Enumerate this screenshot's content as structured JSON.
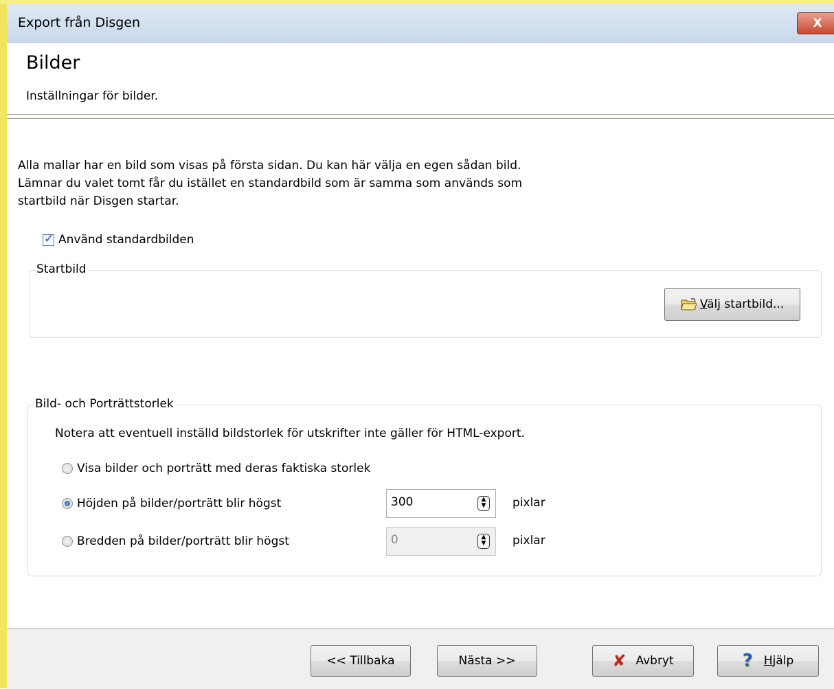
{
  "window": {
    "title": "Export från Disgen",
    "close_label": "X",
    "colors": {
      "accent_yellow": "#f0e460",
      "titlebar": "#c9d8ea",
      "close_red": "#c6492f"
    }
  },
  "header": {
    "title": "Bilder",
    "subtitle": "Inställningar för bilder."
  },
  "intro": {
    "line1": "Alla mallar har en bild som visas på första sidan. Du kan här välja en egen sådan bild.",
    "line2": "Lämnar du valet tomt får du istället en standardbild som är samma som används som",
    "line3": "startbild när Disgen startar."
  },
  "use_default": {
    "label": "Använd standardbilden",
    "checked": true
  },
  "startbild": {
    "legend": "Startbild",
    "button_prefix": "",
    "button_accel": "V",
    "button_rest": "älj startbild...",
    "icon": "folder-open-icon"
  },
  "size_group": {
    "legend": "Bild- och Porträttstorlek",
    "note": "Notera att eventuell inställd bildstorlek för utskrifter inte gäller för HTML-export.",
    "options": [
      {
        "label": "Visa bilder och porträtt med deras faktiska storlek",
        "selected": false
      },
      {
        "label": "Höjden på bilder/porträtt blir högst",
        "selected": true,
        "value": "300",
        "unit": "pixlar",
        "enabled": true
      },
      {
        "label": "Bredden på bilder/porträtt blir högst",
        "selected": false,
        "value": "0",
        "unit": "pixlar",
        "enabled": false
      }
    ]
  },
  "footer": {
    "back": "<< Tillbaka",
    "next": "Nästa >>",
    "cancel": "Avbryt",
    "help_accel": "H",
    "help_rest": "jälp",
    "cancel_icon": "x-cancel-icon",
    "help_icon": "question-icon"
  }
}
